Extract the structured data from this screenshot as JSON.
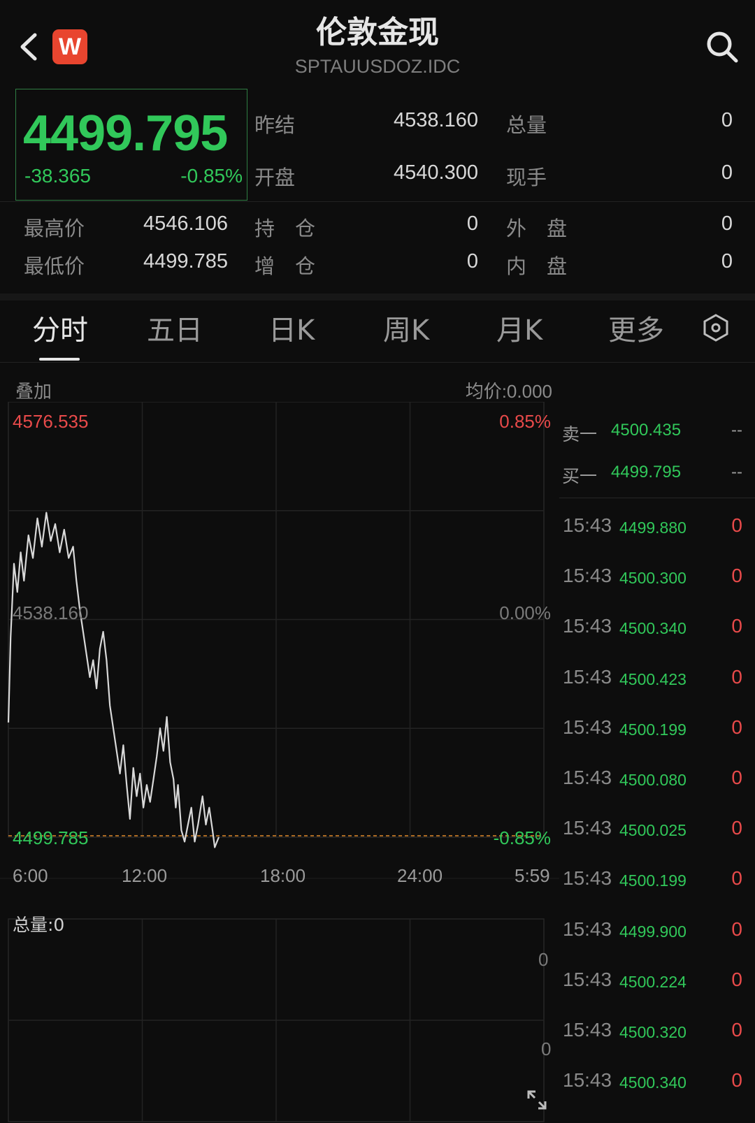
{
  "header": {
    "title": "伦敦金现",
    "code": "SPTAUUSDOZ.IDC",
    "logo_letter": "W",
    "icons": {
      "back": "chevron-left-icon",
      "search": "search-icon",
      "settings": "hexagon-settings-icon",
      "expand": "expand-icon"
    }
  },
  "quote": {
    "price": "4499.795",
    "change": "-38.365",
    "change_pct": "-0.85%",
    "rows": [
      [
        {
          "label": "昨结",
          "value": "4538.160"
        },
        {
          "label": "总量",
          "value": "0"
        }
      ],
      [
        {
          "label": "开盘",
          "value": "4540.300"
        },
        {
          "label": "现手",
          "value": "0"
        }
      ]
    ],
    "stats": [
      [
        {
          "label": "最高价",
          "value": "4546.106"
        },
        {
          "label": "持　仓",
          "value": "0"
        },
        {
          "label": "外　盘",
          "value": "0"
        }
      ],
      [
        {
          "label": "最低价",
          "value": "4499.785"
        },
        {
          "label": "增　仓",
          "value": "0"
        },
        {
          "label": "内　盘",
          "value": "0"
        }
      ]
    ]
  },
  "tabs": [
    "分时",
    "五日",
    "日K",
    "周K",
    "月K",
    "更多"
  ],
  "active_tab": 0,
  "chart_labels": {
    "overlay": "叠加",
    "avg_price": "均价:0.000",
    "total_volume": "总量:0"
  },
  "colors": {
    "up": "#e84a4a",
    "down": "#31c85a",
    "line": "#d9d9d9",
    "bg": "#0d0d0d"
  },
  "orderbook": [
    {
      "label": "卖一",
      "price": "4500.435",
      "volume": "--"
    },
    {
      "label": "买一",
      "price": "4499.795",
      "volume": "--"
    }
  ],
  "ticks": [
    {
      "time": "15:43",
      "price": "4499.880",
      "volume": "0"
    },
    {
      "time": "15:43",
      "price": "4500.300",
      "volume": "0"
    },
    {
      "time": "15:43",
      "price": "4500.340",
      "volume": "0"
    },
    {
      "time": "15:43",
      "price": "4500.423",
      "volume": "0"
    },
    {
      "time": "15:43",
      "price": "4500.199",
      "volume": "0"
    },
    {
      "time": "15:43",
      "price": "4500.080",
      "volume": "0"
    },
    {
      "time": "15:43",
      "price": "4500.025",
      "volume": "0"
    },
    {
      "time": "15:43",
      "price": "4500.199",
      "volume": "0"
    },
    {
      "time": "15:43",
      "price": "4499.900",
      "volume": "0"
    },
    {
      "time": "15:43",
      "price": "4500.224",
      "volume": "0"
    },
    {
      "time": "15:43",
      "price": "4500.320",
      "volume": "0"
    },
    {
      "time": "15:43",
      "price": "4500.340",
      "volume": "0"
    }
  ],
  "chart_data": {
    "type": "line",
    "y_left_ticks": [
      "4576.535",
      "4538.160",
      "4499.785"
    ],
    "y_right_ticks": [
      "0.85%",
      "0.00%",
      "-0.85%"
    ],
    "x_ticks": [
      "6:00",
      "12:00",
      "18:00",
      "24:00",
      "5:59"
    ],
    "ylim": [
      4499.785,
      4576.535
    ],
    "reference": 4538.16,
    "x_range_hours": [
      6,
      30
    ],
    "volume_ticks": [
      "0",
      "0"
    ],
    "series": [
      {
        "points": [
          [
            6.0,
            4520
          ],
          [
            6.1,
            4535
          ],
          [
            6.25,
            4548
          ],
          [
            6.4,
            4543
          ],
          [
            6.55,
            4550
          ],
          [
            6.7,
            4545
          ],
          [
            6.9,
            4553
          ],
          [
            7.1,
            4549
          ],
          [
            7.3,
            4556
          ],
          [
            7.5,
            4551
          ],
          [
            7.7,
            4557
          ],
          [
            7.9,
            4552
          ],
          [
            8.1,
            4555
          ],
          [
            8.3,
            4550
          ],
          [
            8.5,
            4554
          ],
          [
            8.7,
            4549
          ],
          [
            8.9,
            4551
          ],
          [
            9.05,
            4545
          ],
          [
            9.2,
            4540
          ],
          [
            9.35,
            4536
          ],
          [
            9.5,
            4532
          ],
          [
            9.65,
            4528
          ],
          [
            9.8,
            4531
          ],
          [
            9.95,
            4526
          ],
          [
            10.1,
            4533
          ],
          [
            10.25,
            4536
          ],
          [
            10.4,
            4531
          ],
          [
            10.55,
            4523
          ],
          [
            10.7,
            4519
          ],
          [
            10.85,
            4515
          ],
          [
            11.0,
            4511
          ],
          [
            11.15,
            4516
          ],
          [
            11.3,
            4509
          ],
          [
            11.45,
            4503
          ],
          [
            11.6,
            4512
          ],
          [
            11.75,
            4507
          ],
          [
            11.9,
            4511
          ],
          [
            12.05,
            4505
          ],
          [
            12.2,
            4509
          ],
          [
            12.35,
            4506
          ],
          [
            12.5,
            4510
          ],
          [
            12.65,
            4514
          ],
          [
            12.8,
            4519
          ],
          [
            12.95,
            4515
          ],
          [
            13.1,
            4521
          ],
          [
            13.25,
            4513
          ],
          [
            13.4,
            4510
          ],
          [
            13.5,
            4505
          ],
          [
            13.6,
            4509
          ],
          [
            13.75,
            4501
          ],
          [
            13.9,
            4499
          ],
          [
            14.05,
            4502
          ],
          [
            14.2,
            4505
          ],
          [
            14.35,
            4499
          ],
          [
            14.5,
            4502
          ],
          [
            14.7,
            4507
          ],
          [
            14.85,
            4502
          ],
          [
            15.0,
            4505
          ],
          [
            15.15,
            4501
          ],
          [
            15.25,
            4498
          ],
          [
            15.43,
            4499.795
          ]
        ]
      }
    ]
  }
}
